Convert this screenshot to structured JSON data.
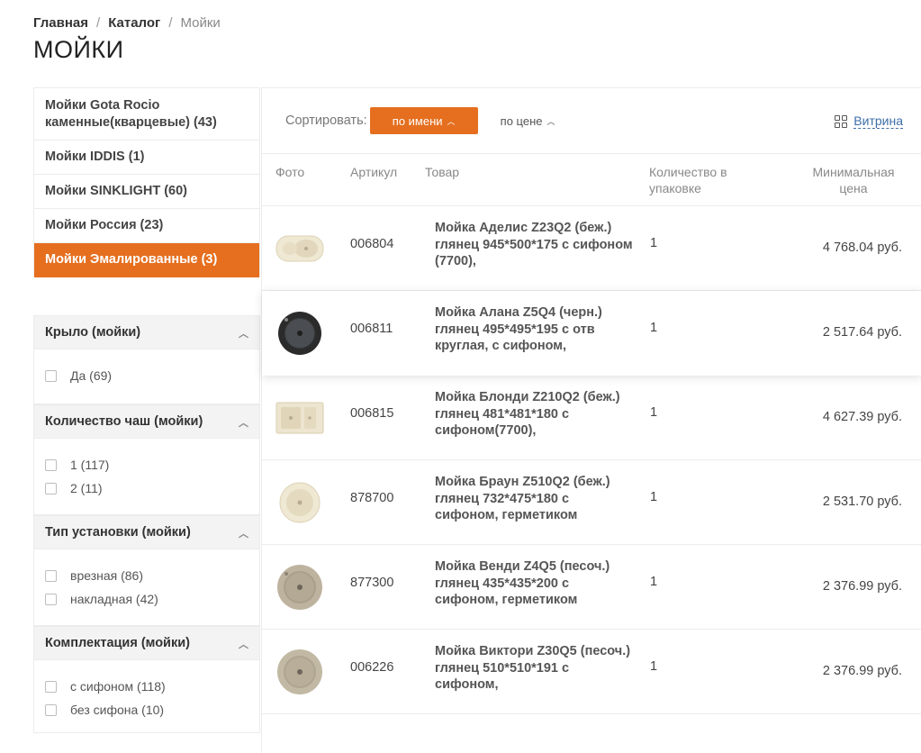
{
  "breadcrumb": {
    "home": "Главная",
    "catalog": "Каталог",
    "current": "Мойки",
    "sep": "/"
  },
  "page_title": "МОЙКИ",
  "categories": [
    {
      "label": "Мойки Gota Rocio каменные(кварцевые) (43)"
    },
    {
      "label": "Мойки IDDIS (1)"
    },
    {
      "label": "Мойки SINKLIGHT (60)"
    },
    {
      "label": "Мойки Россия (23)"
    },
    {
      "label": "Мойки Эмалированные (3)",
      "active": true
    }
  ],
  "filters": [
    {
      "title": "Крыло (мойки)",
      "options": [
        "Да (69)"
      ]
    },
    {
      "title": "Количество чаш (мойки)",
      "options": [
        "1 (117)",
        "2 (11)"
      ]
    },
    {
      "title": "Тип установки (мойки)",
      "options": [
        "врезная (86)",
        "накладная (42)"
      ]
    },
    {
      "title": "Комплектация (мойки)",
      "options": [
        "с сифоном (118)",
        "без сифона (10)"
      ]
    }
  ],
  "sort": {
    "label": "Сортировать:",
    "by_name": "по имени",
    "by_price": "по цене",
    "view": "Витрина"
  },
  "columns": {
    "photo": "Фото",
    "sku": "Артикул",
    "product": "Товар",
    "qty": "Количество в упаковке",
    "price": "Минимальная цена"
  },
  "products": [
    {
      "sku": "006804",
      "name": "Мойка Аделис Z23Q2 (беж.) глянец 945*500*175 с сифоном (7700),",
      "qty": "1",
      "price": "4 768.04 руб.",
      "thumb": "rect-double-beige"
    },
    {
      "sku": "006811",
      "name": "Мойка Алана Z5Q4 (черн.) глянец 495*495*195 с отв круглая, с сифоном,",
      "qty": "1",
      "price": "2 517.64 руб.",
      "thumb": "round-black"
    },
    {
      "sku": "006815",
      "name": "Мойка Блонди Z210Q2 (беж.) глянец 481*481*180 с сифоном(7700),",
      "qty": "1",
      "price": "4 627.39 руб.",
      "thumb": "rect-two-bowl-beige"
    },
    {
      "sku": "878700",
      "name": "Мойка Браун Z510Q2 (беж.) глянец 732*475*180 с сифоном, герметиком",
      "qty": "1",
      "price": "2 531.70 руб.",
      "thumb": "round-beige"
    },
    {
      "sku": "877300",
      "name": "Мойка Венди Z4Q5 (песоч.) глянец 435*435*200 с сифоном, герметиком",
      "qty": "1",
      "price": "2 376.99 руб.",
      "thumb": "round-sand"
    },
    {
      "sku": "006226",
      "name": "Мойка Виктори Z30Q5 (песоч.) глянец 510*510*191 с сифоном,",
      "qty": "1",
      "price": "2 376.99 руб.",
      "thumb": "round-sand"
    }
  ],
  "colors": {
    "accent": "#e56f1f",
    "link": "#3d6ea8"
  }
}
